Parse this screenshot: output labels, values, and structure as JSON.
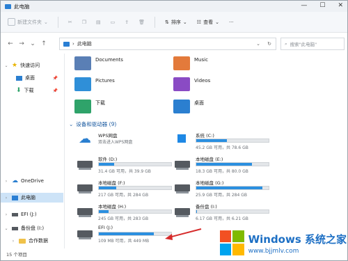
{
  "window": {
    "title": "此电脑",
    "controls": [
      "—",
      "☐",
      "✕"
    ]
  },
  "toolbar": {
    "new_label": "新建文件夹",
    "sort_label": "排序",
    "view_label": "查看",
    "more_label": "···"
  },
  "address": {
    "path": "此电脑",
    "search_placeholder": "搜索\"此电脑\""
  },
  "sidebar": {
    "quick_access": "快速访问",
    "desktop": "桌面",
    "downloads": "下载",
    "onedrive": "OneDrive",
    "this_pc": "此电脑",
    "efi": "EFI (J:)",
    "backup": "备份盘 (I:)",
    "cooperation": "合作数据"
  },
  "folders": [
    {
      "name": "Documents",
      "color": "#5a7fb5"
    },
    {
      "name": "Music",
      "color": "#e37a3b"
    },
    {
      "name": "Pictures",
      "color": "#2f8fd8"
    },
    {
      "name": "Videos",
      "color": "#8a4bc4"
    },
    {
      "name": "下载",
      "color": "#2fa36a"
    },
    {
      "name": "桌面",
      "color": "#2b7fd0"
    }
  ],
  "section_title": "设备和驱动器 (9)",
  "drives": [
    {
      "name": "WPS网盘",
      "info": "双击进入WPS网盘",
      "fill": 0
    },
    {
      "name": "系统 (C:)",
      "info": "45.2 GB 可用，共 78.6 GB",
      "fill": 0.42
    },
    {
      "name": "软件 (D:)",
      "info": "31.4 GB 可用，共 39.9 GB",
      "fill": 0.21
    },
    {
      "name": "本地磁盘 (E:)",
      "info": "18.3 GB 可用，共 80.0 GB",
      "fill": 0.77
    },
    {
      "name": "本地磁盘 (F:)",
      "info": "217 GB 可用，共 284 GB",
      "fill": 0.24
    },
    {
      "name": "本地磁盘 (G:)",
      "info": "25.9 GB 可用，共 284 GB",
      "fill": 0.91
    },
    {
      "name": "本地磁盘 (H:)",
      "info": "245 GB 可用，共 283 GB",
      "fill": 0.13
    },
    {
      "name": "备份盘 (I:)",
      "info": "6.17 GB 可用，共 6.21 GB",
      "fill": 0.01
    },
    {
      "name": "EFI (J:)",
      "info": "109 MB 可用，共 449 MB",
      "fill": 0.76
    }
  ],
  "status": "15 个项目",
  "watermark": {
    "title": "Windows 系统之家",
    "url": "www.bjjmlv.com"
  }
}
